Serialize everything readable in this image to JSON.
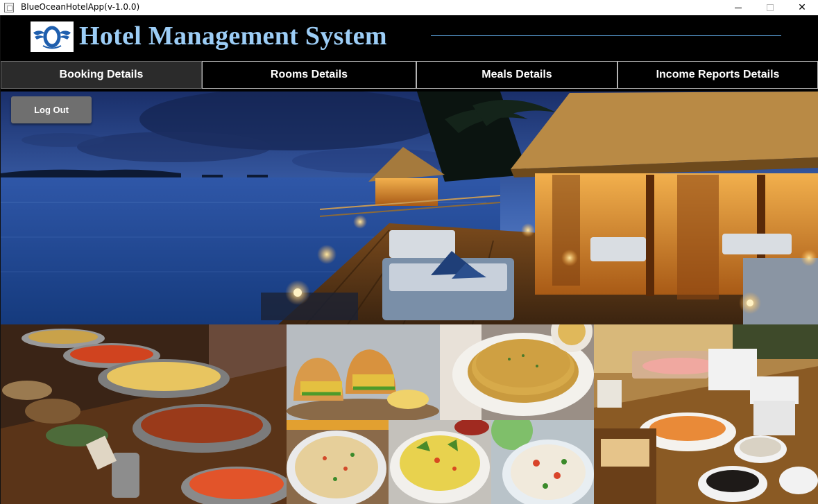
{
  "window": {
    "title": "BlueOceanHotelApp(v-1.0.0)",
    "controls": {
      "minimize_icon": "minimize-icon",
      "maximize_icon": "maximize-icon",
      "close_icon": "close-icon",
      "close_glyph": "✕"
    }
  },
  "header": {
    "title": "Hotel Management System",
    "logo_icon": "winged-o-logo",
    "title_color": "#9ccdf6",
    "rule_color": "#5aa0d8"
  },
  "nav": {
    "tabs": [
      {
        "label": "Booking Details",
        "active": true
      },
      {
        "label": "Rooms Details",
        "active": false
      },
      {
        "label": "Meals Details",
        "active": false
      },
      {
        "label": "Income Reports Details",
        "active": false
      }
    ]
  },
  "hero": {
    "logout_label": "Log Out",
    "image": "resort-deck-at-dusk-photo"
  },
  "collage": {
    "images": [
      "buffet-curry-pots-photo",
      "vada-pav-sandwich-photo",
      "paratha-flatbread-photo",
      "uttapam-pancake-photo",
      "upma-dish-photo",
      "rice-salad-photo",
      "buffet-spread-photo"
    ]
  }
}
